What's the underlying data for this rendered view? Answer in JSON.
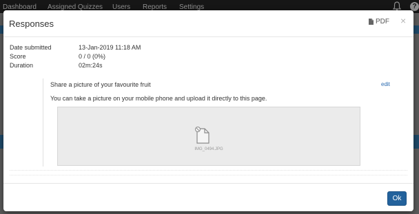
{
  "nav": {
    "items": [
      "Dashboard",
      "Assigned Quizzes",
      "Users",
      "Reports",
      "Settings"
    ],
    "help_glyph": "?"
  },
  "modal": {
    "title": "Responses",
    "pdf_label": "PDF",
    "close_glyph": "×",
    "details": [
      {
        "label": "Date submitted",
        "value": "13-Jan-2019 11:18 AM"
      },
      {
        "label": "Score",
        "value": "0 / 0 (0%)"
      },
      {
        "label": "Duration",
        "value": "02m:24s"
      }
    ],
    "question": {
      "text": "Share a picture of your favourite fruit",
      "edit_label": "edit",
      "instructions": "You can take a picture on your mobile phone and upload it directly to this page.",
      "file_name": "IMG_0494.JPG"
    },
    "ok_label": "Ok"
  },
  "colors": {
    "primary": "#23629c",
    "link": "#2a6bb0",
    "navbar": "#161616"
  },
  "icons": [
    "bell-icon",
    "help-icon",
    "pdf-icon",
    "close-icon",
    "image-file-icon"
  ]
}
